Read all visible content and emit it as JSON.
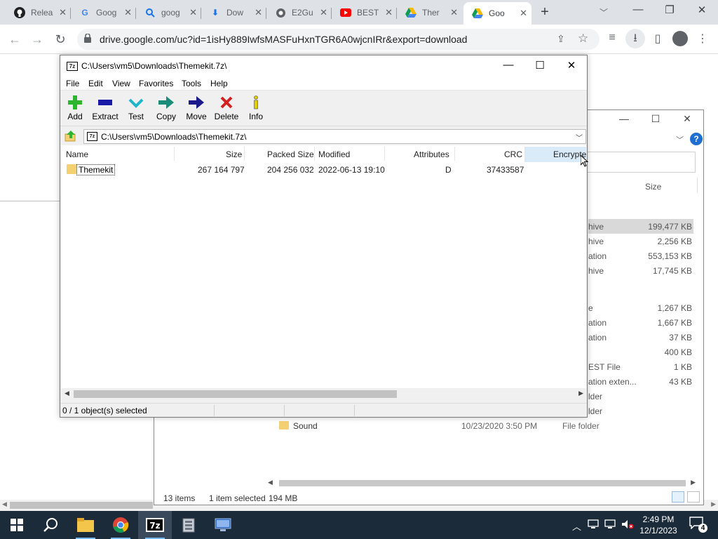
{
  "browser": {
    "tabs": [
      {
        "title": "Relea",
        "icon": "github-icon"
      },
      {
        "title": "Goog",
        "icon": "google-icon"
      },
      {
        "title": "goog",
        "icon": "search-icon"
      },
      {
        "title": "Dow",
        "icon": "download-icon"
      },
      {
        "title": "E2Gu",
        "icon": "globe-icon"
      },
      {
        "title": "BEST",
        "icon": "youtube-icon"
      },
      {
        "title": "Ther",
        "icon": "google-drive-icon"
      },
      {
        "title": "Goo",
        "icon": "google-drive-icon",
        "active": true
      }
    ],
    "url": "drive.google.com/uc?id=1isHy889IwfsMASFuHxnTGR6A0wjcnIRr&export=download"
  },
  "zip": {
    "title": "C:\\Users\\vm5\\Downloads\\Themekit.7z\\",
    "app_icon": "7z",
    "menu": [
      "File",
      "Edit",
      "View",
      "Favorites",
      "Tools",
      "Help"
    ],
    "toolbar": [
      {
        "label": "Add",
        "icon": "add-icon",
        "color": "#2db52d"
      },
      {
        "label": "Extract",
        "icon": "extract-icon",
        "color": "#1a1aa8"
      },
      {
        "label": "Test",
        "icon": "test-icon",
        "color": "#1fb5c9"
      },
      {
        "label": "Copy",
        "icon": "copy-icon",
        "color": "#1a8c7a"
      },
      {
        "label": "Move",
        "icon": "move-icon",
        "color": "#1a1a8c"
      },
      {
        "label": "Delete",
        "icon": "delete-icon",
        "color": "#d42020"
      },
      {
        "label": "Info",
        "icon": "info-icon",
        "color": "#e0d000"
      }
    ],
    "address": "C:\\Users\\vm5\\Downloads\\Themekit.7z\\",
    "columns": [
      "Name",
      "Size",
      "Packed Size",
      "Modified",
      "Attributes",
      "CRC",
      "Encrypte"
    ],
    "rows": [
      {
        "name": "Themekit",
        "size": "267 164 797",
        "packed": "204 256 032",
        "modified": "2022-06-13 19:10",
        "attributes": "D",
        "crc": "37433587"
      }
    ],
    "status": "0 / 1 object(s) selected"
  },
  "explorer": {
    "size_header": "Size",
    "rows": [
      {
        "type": "hive",
        "size": "199,477 KB",
        "selected": true
      },
      {
        "type": "hive",
        "size": "2,256 KB"
      },
      {
        "type": "ation",
        "size": "553,153 KB"
      },
      {
        "type": "hive",
        "size": "17,745 KB"
      },
      {
        "type": "e",
        "size": "1,267 KB"
      },
      {
        "type": "ation",
        "size": "1,667 KB"
      },
      {
        "type": "ation",
        "size": "37 KB"
      },
      {
        "type": "",
        "size": "400 KB"
      },
      {
        "type": "EST File",
        "size": "1 KB"
      },
      {
        "type": "ation exten...",
        "size": "43 KB"
      },
      {
        "type": "lder",
        "size": ""
      },
      {
        "type": "lder",
        "size": ""
      }
    ],
    "sound": {
      "name": "Sound",
      "date": "10/23/2020 3:50 PM",
      "type": "File folder"
    },
    "status": {
      "items": "13 items",
      "selected": "1 item selected",
      "size": "194 MB"
    }
  },
  "taskbar": {
    "time": "2:49 PM",
    "date": "12/1/2023",
    "notification_count": "4",
    "apps": [
      "start-icon",
      "search-icon",
      "file-explorer-icon",
      "chrome-icon",
      "7zip-icon",
      "server-manager-icon",
      "remote-desktop-icon"
    ]
  }
}
